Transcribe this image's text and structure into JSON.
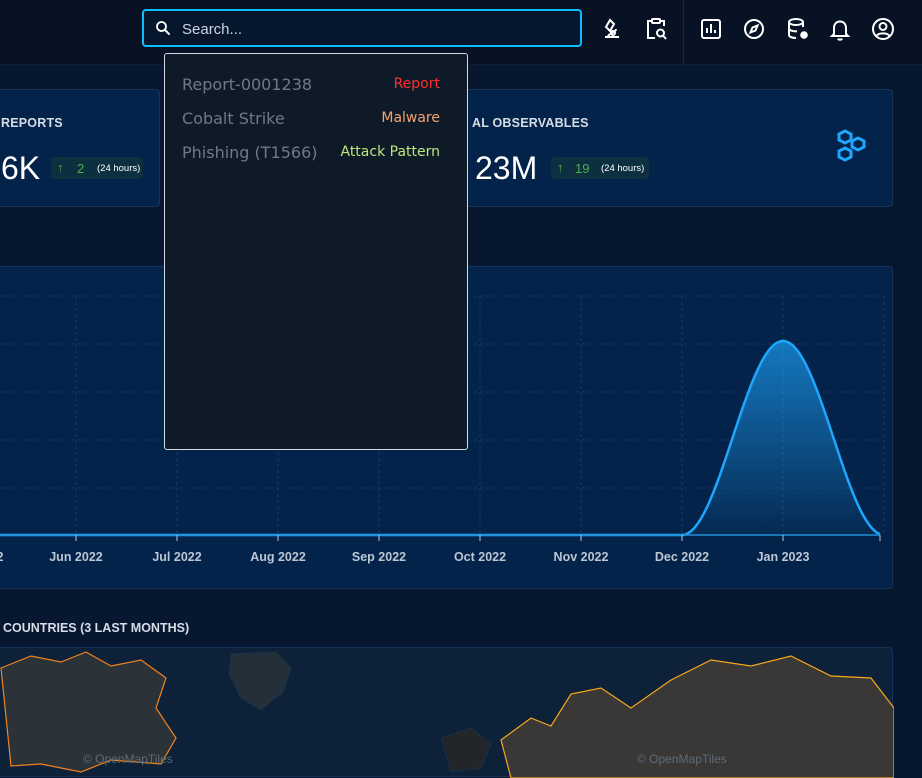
{
  "topbar": {
    "search_placeholder": "Search...",
    "icons": [
      "search-icon",
      "investigate-icon",
      "search-case-icon",
      "dashboard-icon",
      "explore-icon",
      "data-settings-icon",
      "notifications-icon",
      "profile-icon"
    ]
  },
  "cards": {
    "reports": {
      "title": "REPORTS",
      "value": "6K",
      "delta": "2",
      "period": "(24 hours)"
    },
    "observables": {
      "title": "AL OBSERVABLES",
      "value": "23M",
      "delta": "19",
      "period": "(24 hours)"
    }
  },
  "chart_data": {
    "type": "area",
    "x": [
      "Jun 2022",
      "Jul 2022",
      "Aug 2022",
      "Sep 2022",
      "Oct 2022",
      "Nov 2022",
      "Dec 2022",
      "Jan 2023"
    ],
    "tick_labels": [
      "2",
      "Jun 2022",
      "Jul 2022",
      "Aug 2022",
      "Sep 2022",
      "Oct 2022",
      "Nov 2022",
      "Dec 2022",
      "Jan 2023"
    ],
    "values": [
      0,
      0,
      0,
      0,
      0,
      0,
      0,
      1
    ],
    "grid": true,
    "color": "#1ea7ff"
  },
  "map": {
    "title": "COUNTRIES (3 LAST MONTHS)",
    "watermark": "© OpenMapTiles"
  },
  "dropdown": {
    "items": [
      {
        "name": "Report-0001238",
        "type": "Report",
        "color": "#ff2d2d"
      },
      {
        "name": "Cobalt Strike",
        "type": "Malware",
        "color": "#f7a26b"
      },
      {
        "name": "Phishing (T1566)",
        "type": "Attack Pattern",
        "color": "#b9e87b"
      }
    ]
  },
  "colors": {
    "accent": "#0fbcff",
    "background": "#071730",
    "card": "#04234a"
  }
}
